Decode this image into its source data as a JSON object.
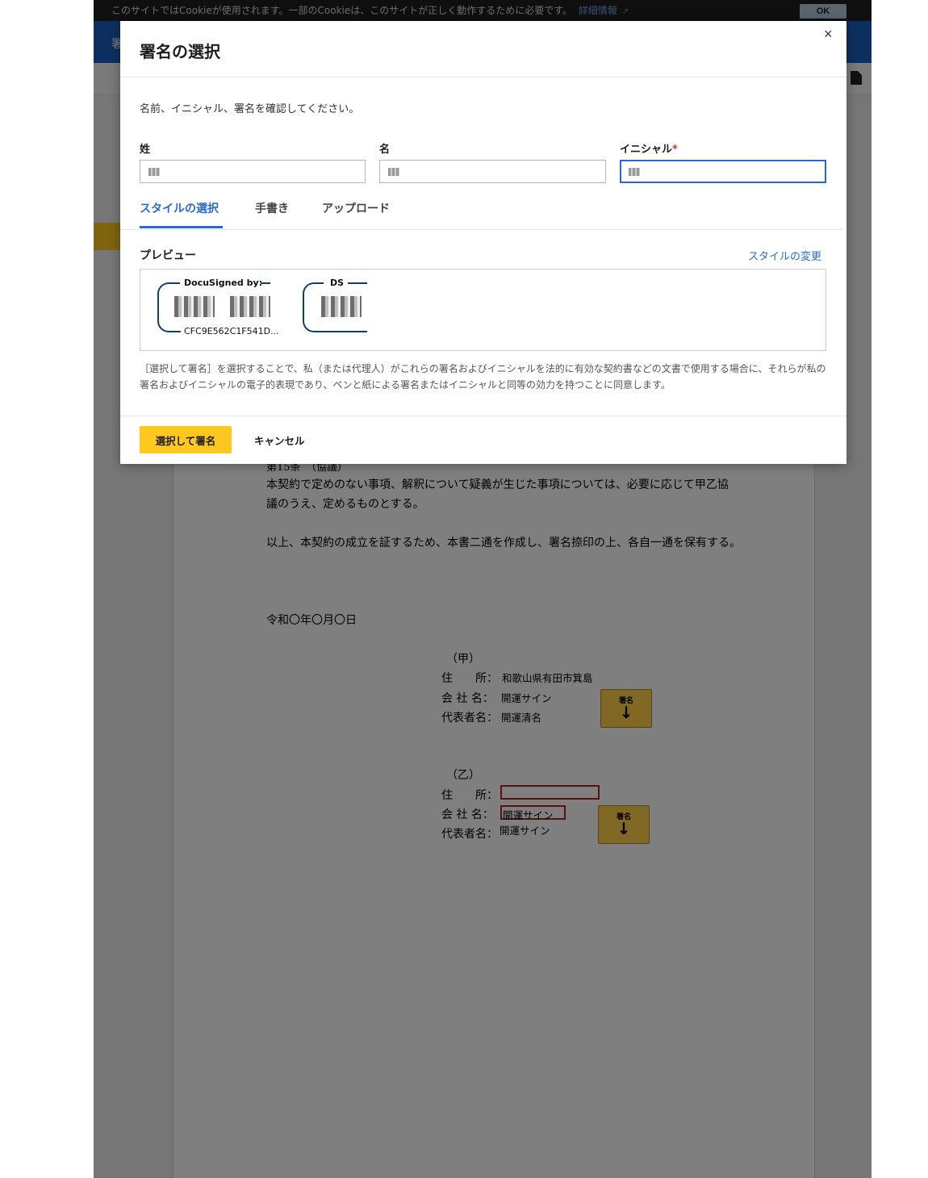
{
  "cookie_bar": {
    "message": "このサイトではCookieが使用されます。一部のCookieは、このサイトが正しく動作するために必要です。",
    "link_label": "詳細情報",
    "ok_label": "OK"
  },
  "header": {
    "title_partial": "署"
  },
  "document": {
    "article_heading_partial": "第15条　（協議）",
    "paragraph_1_line_1": "本契約で定めのない事項、解釈について疑義が生じた事項については、必要に応じて甲乙協",
    "paragraph_1_line_2": "議のうえ、定めるものとする。",
    "paragraph_2": "以上、本契約の成立を証するため、本書二通を作成し、署名捺印の上、各自一通を保有する。",
    "date": "令和〇年〇月〇日",
    "party_a": {
      "label": "（甲）",
      "address_label": "住　　所：",
      "address_value": "和歌山県有田市箕島",
      "company_label": "会 社 名：",
      "company_value": "開運サイン",
      "rep_label": "代表者名：",
      "rep_value": "開運清名",
      "sign_tag_label": "署名"
    },
    "party_b": {
      "label": "（乙）",
      "address_label": "住　　所：",
      "company_label": "会 社 名：",
      "company_value": "開運サイン",
      "rep_label": "代表者名：",
      "rep_value": "開運サイン",
      "sign_tag_label": "署名"
    }
  },
  "modal": {
    "title": "署名の選択",
    "close_label": "×",
    "instruction": "名前、イニシャル、署名を確認してください。",
    "fields": {
      "last_name_label": "姓",
      "first_name_label": "名",
      "initials_label": "イニシャル",
      "required_mark": "*"
    },
    "tabs": [
      {
        "label": "スタイルの選択",
        "active": true
      },
      {
        "label": "手書き",
        "active": false
      },
      {
        "label": "アップロード",
        "active": false
      }
    ],
    "preview_label": "プレビュー",
    "change_style_label": "スタイルの変更",
    "signature_caption": "DocuSigned by:",
    "signature_id": "CFC9E562C1F541D...",
    "initials_caption": "DS",
    "legal_text": "［選択して署名］を選択することで、私（または代理人）がこれらの署名およびイニシャルを法的に有効な契約書などの文書で使用する場合に、それらが私の署名およびイニシャルの電子的表現であり、ペンと紙による署名またはイニシャルと同等の効力を持つことに同意します。",
    "primary_button": "選択して署名",
    "cancel_button": "キャンセル"
  },
  "colors": {
    "header_blue": "#1b5fc1",
    "accent_yellow": "#ffc820",
    "link_blue": "#2a6ad3",
    "signature_frame": "#0f3d7a"
  },
  "icons": [
    "external-link-icon",
    "document-icon",
    "close-icon",
    "download-arrow-icon"
  ]
}
